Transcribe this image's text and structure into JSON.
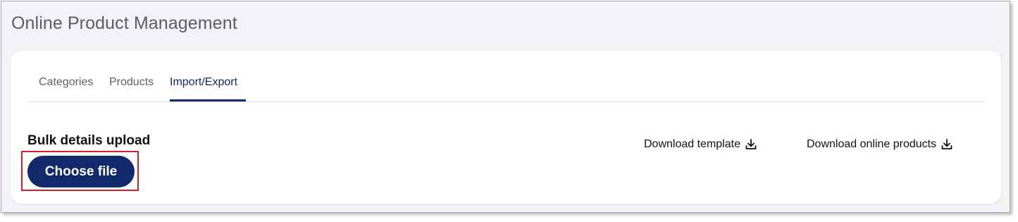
{
  "page": {
    "title": "Online Product Management"
  },
  "tabs": [
    {
      "label": "Categories",
      "active": false
    },
    {
      "label": "Products",
      "active": false
    },
    {
      "label": "Import/Export",
      "active": true
    }
  ],
  "import_export": {
    "section_title": "Bulk details upload",
    "choose_file_label": "Choose file",
    "download_template_label": "Download template",
    "download_online_products_label": "Download online products",
    "download_icon": "download-icon"
  },
  "colors": {
    "primary": "#122a6c",
    "active_tab": "#162866",
    "highlight": "#d41f27",
    "background": "#f2f3f6"
  }
}
